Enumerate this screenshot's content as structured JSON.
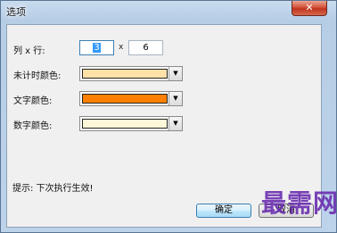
{
  "window": {
    "title": "选项",
    "close_glyph": "✕"
  },
  "form": {
    "grid_label": "列 x 行:",
    "cols_value": "3",
    "times_glyph": "x",
    "rows_value": "6",
    "unrevealed_color_label": "未计时颜色:",
    "text_color_label": "文字颜色:",
    "number_color_label": "数字颜色:",
    "dropdown_glyph": "▼"
  },
  "colors": {
    "unrevealed": "#ffe0a8",
    "text": "#ff8000",
    "number": "#fbf7d8"
  },
  "hint": "提示: 下次执行生效!",
  "buttons": {
    "ok": "确定",
    "cancel": "取消"
  },
  "watermark": "最需网"
}
